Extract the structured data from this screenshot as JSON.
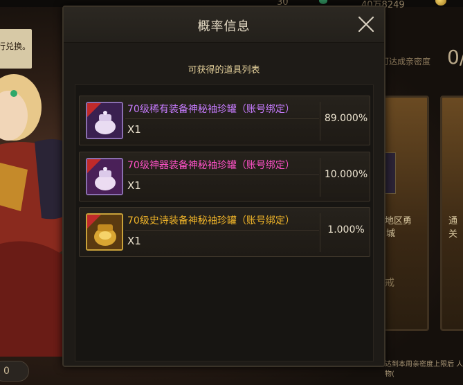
{
  "background": {
    "hint_text": "行兑换。",
    "top_stats": [
      "30",
      "40万8249"
    ],
    "right_label": "间可达成亲密度",
    "right_value": "0/",
    "card_texts": [
      "地区勇",
      "城",
      "通关"
    ],
    "card_lock": "戒",
    "bottom_note": "达到本周亲密度上限后 人物(",
    "bottom_pill": "0"
  },
  "dialog": {
    "title": "概率信息",
    "subtitle": "可获得的道具列表",
    "close_icon": "close-icon",
    "items": [
      {
        "name": "70级稀有装备神秘袖珍罐（账号绑定）",
        "quantity": "X1",
        "probability": "89.000%",
        "name_color": "#c77cff",
        "rarity": "rare",
        "icon": "jar-icon"
      },
      {
        "name": "70级神器装备神秘袖珍罐（账号绑定）",
        "quantity": "X1",
        "probability": "10.000%",
        "name_color": "#ff52c8",
        "rarity": "artifact",
        "icon": "jar-icon"
      },
      {
        "name": "70级史诗装备神秘袖珍罐（账号绑定）",
        "quantity": "X1",
        "probability": "1.000%",
        "name_color": "#f0b429",
        "rarity": "epic",
        "icon": "jar-icon"
      }
    ]
  }
}
